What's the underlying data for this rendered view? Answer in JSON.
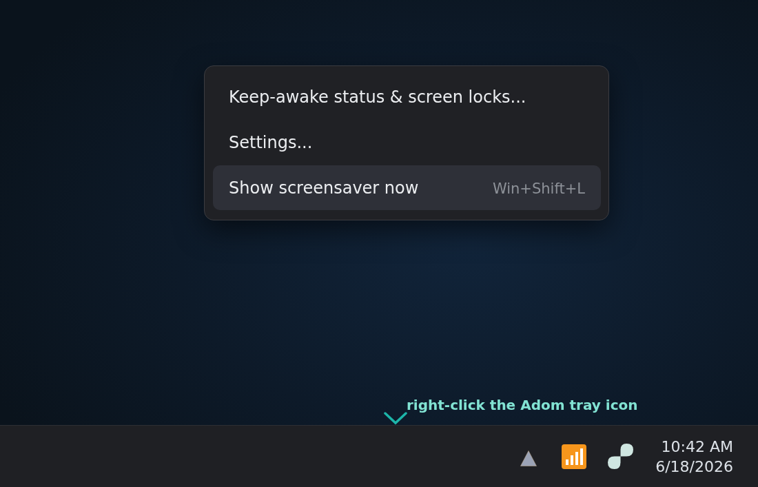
{
  "context_menu": {
    "items": [
      {
        "label": "Keep-awake status & screen locks...",
        "selected": false
      },
      {
        "label": "Settings...",
        "selected": false
      },
      {
        "label": "Show screensaver now",
        "shortcut": "Win+Shift+L",
        "selected": true
      }
    ]
  },
  "annotation": {
    "text": "right-click the Adom tray icon"
  },
  "taskbar": {
    "clock": {
      "time": "10:42 AM",
      "date": "6/18/2026"
    }
  }
}
